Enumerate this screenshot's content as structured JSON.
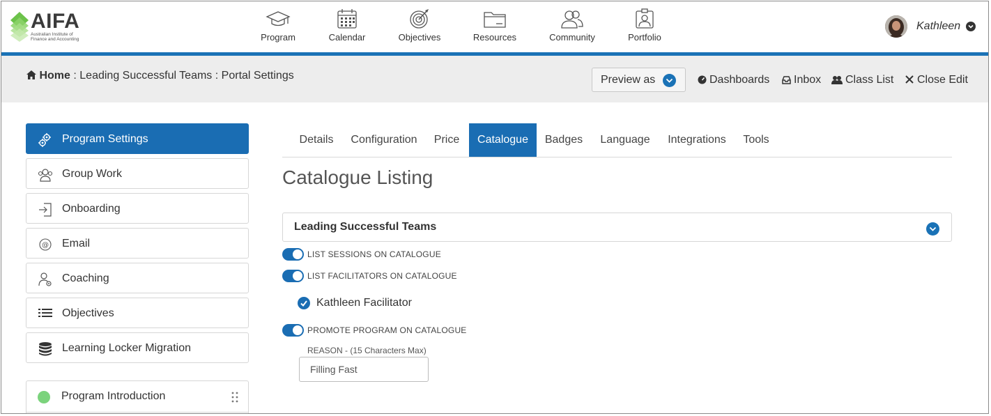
{
  "brand": {
    "name": "AIFA",
    "subtitle": "Australian Institute of Finance and Accounting"
  },
  "nav": {
    "items": [
      {
        "label": "Program",
        "icon": "graduation-cap-icon"
      },
      {
        "label": "Calendar",
        "icon": "calendar-icon"
      },
      {
        "label": "Objectives",
        "icon": "target-icon"
      },
      {
        "label": "Resources",
        "icon": "folder-icon"
      },
      {
        "label": "Community",
        "icon": "people-icon"
      },
      {
        "label": "Portfolio",
        "icon": "id-badge-icon"
      }
    ]
  },
  "user": {
    "name": "Kathleen"
  },
  "breadcrumb": {
    "home": "Home",
    "sep1": ":",
    "program": "Leading Successful Teams",
    "sep2": ":",
    "page": "Portal Settings"
  },
  "toolbar": {
    "preview_label": "Preview as",
    "dashboards": "Dashboards",
    "inbox": "Inbox",
    "class_list": "Class List",
    "close_edit": "Close Edit"
  },
  "sidebar": {
    "items": [
      {
        "label": "Program Settings",
        "icon": "gears-icon",
        "active": true
      },
      {
        "label": "Group Work",
        "icon": "group-icon",
        "active": false
      },
      {
        "label": "Onboarding",
        "icon": "sign-in-icon",
        "active": false
      },
      {
        "label": "Email",
        "icon": "at-icon",
        "active": false
      },
      {
        "label": "Coaching",
        "icon": "user-gear-icon",
        "active": false
      },
      {
        "label": "Objectives",
        "icon": "list-icon",
        "active": false
      },
      {
        "label": "Learning Locker Migration",
        "icon": "database-icon",
        "active": false
      }
    ],
    "phase": {
      "label": "Program Introduction",
      "status_color": "#7bd37c"
    }
  },
  "tabs": [
    {
      "label": "Details",
      "active": false
    },
    {
      "label": "Configuration",
      "active": false
    },
    {
      "label": "Price",
      "active": false
    },
    {
      "label": "Catalogue",
      "active": true
    },
    {
      "label": "Badges",
      "active": false
    },
    {
      "label": "Language",
      "active": false
    },
    {
      "label": "Integrations",
      "active": false
    },
    {
      "label": "Tools",
      "active": false
    }
  ],
  "main": {
    "title": "Catalogue Listing",
    "panel_title": "Leading Successful Teams",
    "toggles": [
      {
        "label": "LIST SESSIONS ON CATALOGUE",
        "on": true
      },
      {
        "label": "LIST FACILITATORS ON CATALOGUE",
        "on": true
      },
      {
        "label": "PROMOTE PROGRAM ON CATALOGUE",
        "on": true
      }
    ],
    "facilitator": {
      "name": "Kathleen Facilitator",
      "checked": true
    },
    "reason": {
      "label": "REASON - (15 Characters Max)",
      "value": "Filling Fast"
    }
  },
  "colors": {
    "accent": "#1a6db3",
    "header_line": "#1a72b6",
    "crumb_bg": "#ededed",
    "logo_green": "#6cc24a"
  }
}
